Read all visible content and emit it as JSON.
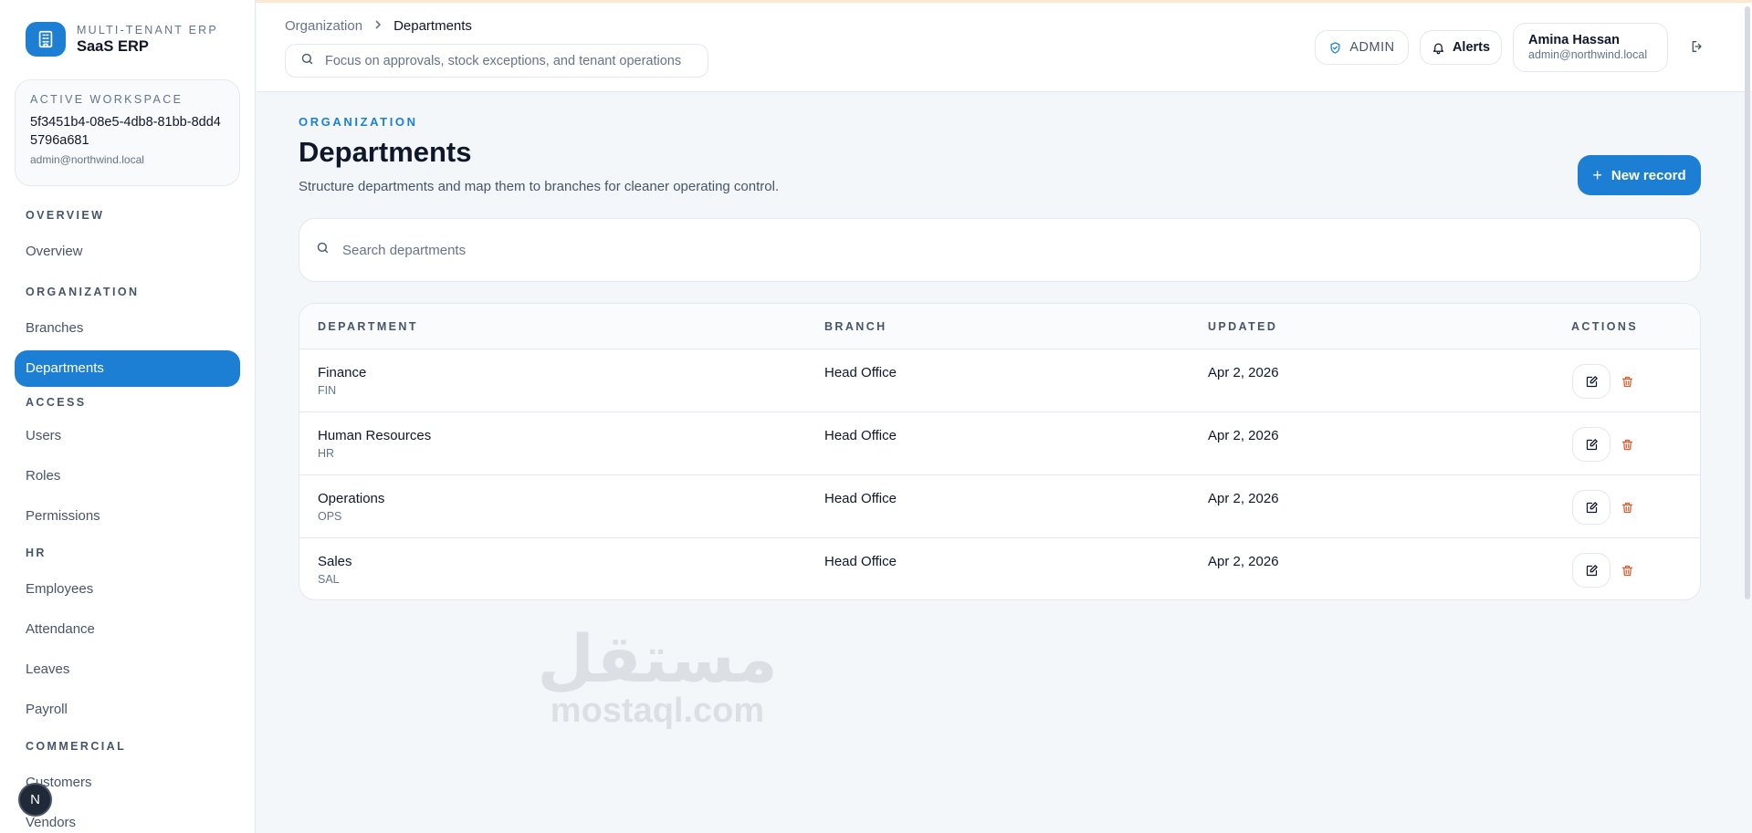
{
  "brand": {
    "subtitle": "MULTI-TENANT ERP",
    "title": "SaaS ERP",
    "logo_icon": "building-icon"
  },
  "workspace": {
    "label": "ACTIVE WORKSPACE",
    "id": "5f3451b4-08e5-4db8-81bb-8dd45796a681",
    "email": "admin@northwind.local"
  },
  "sidebar": {
    "sections": [
      {
        "title": "OVERVIEW",
        "items": [
          {
            "label": "Overview",
            "active": false
          }
        ]
      },
      {
        "title": "ORGANIZATION",
        "items": [
          {
            "label": "Branches",
            "active": false
          },
          {
            "label": "Departments",
            "active": true
          }
        ]
      },
      {
        "title": "ACCESS",
        "items": [
          {
            "label": "Users",
            "active": false
          },
          {
            "label": "Roles",
            "active": false
          },
          {
            "label": "Permissions",
            "active": false
          }
        ]
      },
      {
        "title": "HR",
        "items": [
          {
            "label": "Employees",
            "active": false
          },
          {
            "label": "Attendance",
            "active": false
          },
          {
            "label": "Leaves",
            "active": false
          },
          {
            "label": "Payroll",
            "active": false
          }
        ]
      },
      {
        "title": "COMMERCIAL",
        "items": [
          {
            "label": "Customers",
            "active": false
          },
          {
            "label": "Vendors",
            "active": false
          }
        ]
      }
    ],
    "floating_avatar": "N"
  },
  "header": {
    "breadcrumb": {
      "parent": "Organization",
      "current": "Departments"
    },
    "search_placeholder": "Focus on approvals, stock exceptions, and tenant operations",
    "role_badge": "ADMIN",
    "alerts_label": "Alerts",
    "user": {
      "name": "Amina Hassan",
      "email": "admin@northwind.local"
    }
  },
  "page": {
    "kicker": "ORGANIZATION",
    "title": "Departments",
    "description": "Structure departments and map them to branches for cleaner operating control.",
    "new_button": "New record",
    "search_placeholder": "Search departments"
  },
  "table": {
    "columns": [
      "DEPARTMENT",
      "BRANCH",
      "UPDATED",
      "ACTIONS"
    ],
    "rows": [
      {
        "name": "Finance",
        "code": "FIN",
        "branch": "Head Office",
        "updated": "Apr 2, 2026"
      },
      {
        "name": "Human Resources",
        "code": "HR",
        "branch": "Head Office",
        "updated": "Apr 2, 2026"
      },
      {
        "name": "Operations",
        "code": "OPS",
        "branch": "Head Office",
        "updated": "Apr 2, 2026"
      },
      {
        "name": "Sales",
        "code": "SAL",
        "branch": "Head Office",
        "updated": "Apr 2, 2026"
      }
    ]
  },
  "watermark": {
    "arabic": "مستقل",
    "latin": "mostaql.com"
  },
  "colors": {
    "accent": "#1d7fd3",
    "danger": "#dc5a2a",
    "text": "#0f172a",
    "muted": "#64748b"
  }
}
